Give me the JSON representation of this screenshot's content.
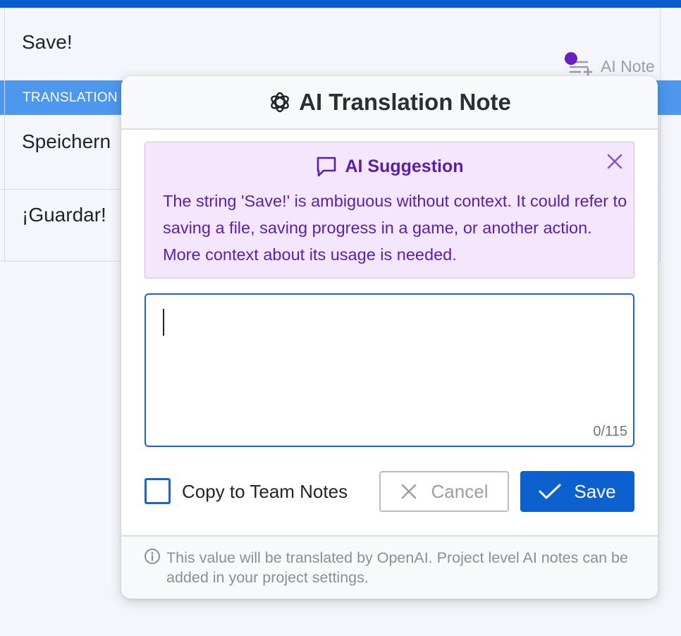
{
  "table": {
    "source_text": "Save!",
    "ai_note_label": "AI Note",
    "translation_header": "TRANSLATION",
    "rows": [
      {
        "text": "Speichern"
      },
      {
        "text": "¡Guardar!"
      }
    ]
  },
  "modal": {
    "title": "AI Translation Note",
    "suggestion": {
      "heading": "AI Suggestion",
      "message": "The string 'Save!' is ambiguous without context. It could refer to saving a file, saving progress in a game, or another action. More context about its usage is needed."
    },
    "note_input": {
      "value": "",
      "counter": "0/115"
    },
    "copy_to_team_label": "Copy to Team Notes",
    "cancel_label": "Cancel",
    "save_label": "Save",
    "footer_info": "This value will be translated by OpenAI. Project level AI notes can be added in your project settings."
  },
  "colors": {
    "primary": "#0d61cf",
    "header_blue": "#4d97ee",
    "suggestion_bg": "#f4e6fd",
    "suggestion_text": "#5a1fa8",
    "note_dot": "#6a1fc2"
  },
  "icons": {
    "title_icon": "openai-logo-icon",
    "suggestion_icon": "chat-bubble-icon",
    "close_icon": "close-icon",
    "cancel_icon": "x-icon",
    "save_icon": "checkmark-icon",
    "info_icon": "info-icon",
    "note_icon": "add-note-icon"
  }
}
